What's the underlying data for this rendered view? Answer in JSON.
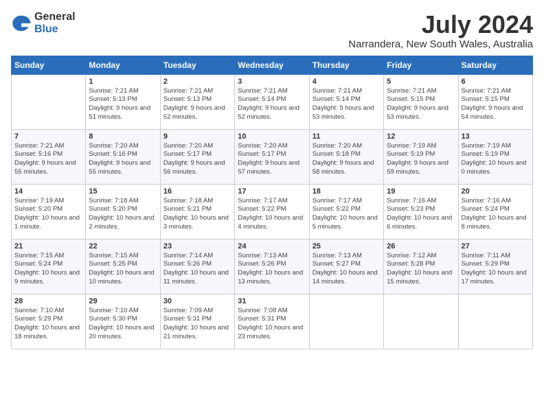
{
  "logo": {
    "general": "General",
    "blue": "Blue"
  },
  "title": "July 2024",
  "location": "Narrandera, New South Wales, Australia",
  "weekdays": [
    "Sunday",
    "Monday",
    "Tuesday",
    "Wednesday",
    "Thursday",
    "Friday",
    "Saturday"
  ],
  "weeks": [
    [
      {
        "day": "",
        "content": ""
      },
      {
        "day": "1",
        "content": "Sunrise: 7:21 AM\nSunset: 5:13 PM\nDaylight: 9 hours\nand 51 minutes."
      },
      {
        "day": "2",
        "content": "Sunrise: 7:21 AM\nSunset: 5:13 PM\nDaylight: 9 hours\nand 52 minutes."
      },
      {
        "day": "3",
        "content": "Sunrise: 7:21 AM\nSunset: 5:14 PM\nDaylight: 9 hours\nand 52 minutes."
      },
      {
        "day": "4",
        "content": "Sunrise: 7:21 AM\nSunset: 5:14 PM\nDaylight: 9 hours\nand 53 minutes."
      },
      {
        "day": "5",
        "content": "Sunrise: 7:21 AM\nSunset: 5:15 PM\nDaylight: 9 hours\nand 53 minutes."
      },
      {
        "day": "6",
        "content": "Sunrise: 7:21 AM\nSunset: 5:15 PM\nDaylight: 9 hours\nand 54 minutes."
      }
    ],
    [
      {
        "day": "7",
        "content": "Sunrise: 7:21 AM\nSunset: 5:16 PM\nDaylight: 9 hours\nand 55 minutes."
      },
      {
        "day": "8",
        "content": "Sunrise: 7:20 AM\nSunset: 5:16 PM\nDaylight: 9 hours\nand 55 minutes."
      },
      {
        "day": "9",
        "content": "Sunrise: 7:20 AM\nSunset: 5:17 PM\nDaylight: 9 hours\nand 56 minutes."
      },
      {
        "day": "10",
        "content": "Sunrise: 7:20 AM\nSunset: 5:17 PM\nDaylight: 9 hours\nand 57 minutes."
      },
      {
        "day": "11",
        "content": "Sunrise: 7:20 AM\nSunset: 5:18 PM\nDaylight: 9 hours\nand 58 minutes."
      },
      {
        "day": "12",
        "content": "Sunrise: 7:19 AM\nSunset: 5:19 PM\nDaylight: 9 hours\nand 59 minutes."
      },
      {
        "day": "13",
        "content": "Sunrise: 7:19 AM\nSunset: 5:19 PM\nDaylight: 10 hours\nand 0 minutes."
      }
    ],
    [
      {
        "day": "14",
        "content": "Sunrise: 7:19 AM\nSunset: 5:20 PM\nDaylight: 10 hours\nand 1 minute."
      },
      {
        "day": "15",
        "content": "Sunrise: 7:18 AM\nSunset: 5:20 PM\nDaylight: 10 hours\nand 2 minutes."
      },
      {
        "day": "16",
        "content": "Sunrise: 7:18 AM\nSunset: 5:21 PM\nDaylight: 10 hours\nand 3 minutes."
      },
      {
        "day": "17",
        "content": "Sunrise: 7:17 AM\nSunset: 5:22 PM\nDaylight: 10 hours\nand 4 minutes."
      },
      {
        "day": "18",
        "content": "Sunrise: 7:17 AM\nSunset: 5:22 PM\nDaylight: 10 hours\nand 5 minutes."
      },
      {
        "day": "19",
        "content": "Sunrise: 7:16 AM\nSunset: 5:23 PM\nDaylight: 10 hours\nand 6 minutes."
      },
      {
        "day": "20",
        "content": "Sunrise: 7:16 AM\nSunset: 5:24 PM\nDaylight: 10 hours\nand 8 minutes."
      }
    ],
    [
      {
        "day": "21",
        "content": "Sunrise: 7:15 AM\nSunset: 5:24 PM\nDaylight: 10 hours\nand 9 minutes."
      },
      {
        "day": "22",
        "content": "Sunrise: 7:15 AM\nSunset: 5:25 PM\nDaylight: 10 hours\nand 10 minutes."
      },
      {
        "day": "23",
        "content": "Sunrise: 7:14 AM\nSunset: 5:26 PM\nDaylight: 10 hours\nand 11 minutes."
      },
      {
        "day": "24",
        "content": "Sunrise: 7:13 AM\nSunset: 5:26 PM\nDaylight: 10 hours\nand 13 minutes."
      },
      {
        "day": "25",
        "content": "Sunrise: 7:13 AM\nSunset: 5:27 PM\nDaylight: 10 hours\nand 14 minutes."
      },
      {
        "day": "26",
        "content": "Sunrise: 7:12 AM\nSunset: 5:28 PM\nDaylight: 10 hours\nand 15 minutes."
      },
      {
        "day": "27",
        "content": "Sunrise: 7:11 AM\nSunset: 5:29 PM\nDaylight: 10 hours\nand 17 minutes."
      }
    ],
    [
      {
        "day": "28",
        "content": "Sunrise: 7:10 AM\nSunset: 5:29 PM\nDaylight: 10 hours\nand 18 minutes."
      },
      {
        "day": "29",
        "content": "Sunrise: 7:10 AM\nSunset: 5:30 PM\nDaylight: 10 hours\nand 20 minutes."
      },
      {
        "day": "30",
        "content": "Sunrise: 7:09 AM\nSunset: 5:31 PM\nDaylight: 10 hours\nand 21 minutes."
      },
      {
        "day": "31",
        "content": "Sunrise: 7:08 AM\nSunset: 5:31 PM\nDaylight: 10 hours\nand 23 minutes."
      },
      {
        "day": "",
        "content": ""
      },
      {
        "day": "",
        "content": ""
      },
      {
        "day": "",
        "content": ""
      }
    ]
  ]
}
